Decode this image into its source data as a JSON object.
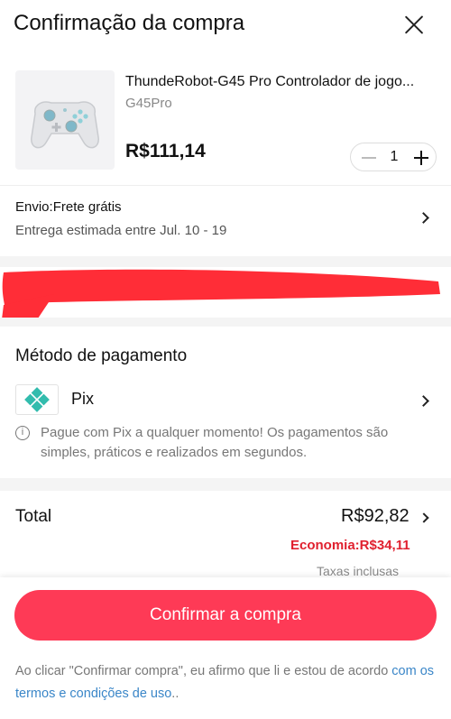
{
  "header": {
    "title": "Confirmação da compra",
    "close_icon": "close-icon"
  },
  "product": {
    "name": "ThundeRobot-G45 Pro Controlador de jogo...",
    "variant": "G45Pro",
    "price": "R$111,14",
    "quantity": "1",
    "image_icon": "game-controller-icon"
  },
  "shipping": {
    "title": "Envio:Frete grátis",
    "estimate": "Entrega estimada entre Jul. 10 - 19"
  },
  "payment": {
    "title": "Método de pagamento",
    "method_label": "Pix",
    "method_icon": "pix-icon",
    "note": "Pague com Pix a qualquer momento! Os pagamentos são simples, práticos e realizados em segundos."
  },
  "summary": {
    "total_label": "Total",
    "total_value": "R$92,82",
    "economy": "Economia:R$34,11",
    "taxes": "Taxas inclusas"
  },
  "footer": {
    "confirm_label": "Confirmar a compra",
    "terms_prefix": "Ao clicar \"Confirmar compra\", eu afirmo que li e estou de acordo ",
    "terms_link": "com os termos e condições de uso",
    "terms_suffix": ".."
  },
  "colors": {
    "accent": "#fe3a56",
    "economy": "#e0202e",
    "link": "#3a86c8",
    "pix": "#32bcad",
    "redaction": "#ff2d37"
  }
}
